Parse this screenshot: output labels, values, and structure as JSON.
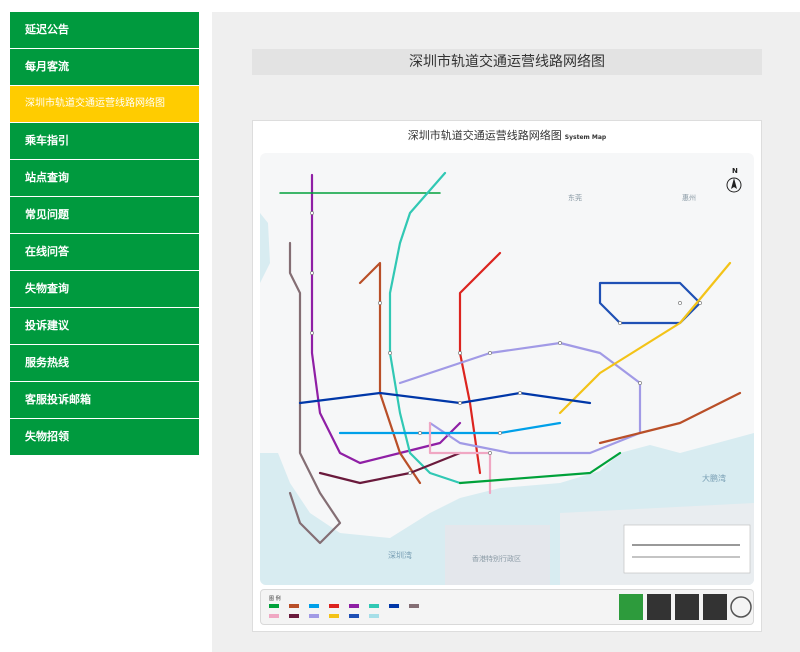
{
  "sidebar": {
    "items": [
      {
        "label": "延迟公告",
        "active": false
      },
      {
        "label": "每月客流",
        "active": false
      },
      {
        "label": "深圳市轨道交通运营线路网络图",
        "active": true
      },
      {
        "label": "乘车指引",
        "active": false
      },
      {
        "label": "站点查询",
        "active": false
      },
      {
        "label": "常见问题",
        "active": false
      },
      {
        "label": "在线问答",
        "active": false
      },
      {
        "label": "失物查询",
        "active": false
      },
      {
        "label": "投诉建议",
        "active": false
      },
      {
        "label": "服务热线",
        "active": false
      },
      {
        "label": "客服投诉邮箱",
        "active": false
      },
      {
        "label": "失物招领",
        "active": false
      }
    ]
  },
  "main": {
    "title": "深圳市轨道交通运营线路网络图",
    "map": {
      "title_cn": "深圳市轨道交通运营线路网络图",
      "title_en": "System Map",
      "north": "N",
      "regions": {
        "dongguan": "东莞",
        "huizhou": "惠州",
        "dapeng_bay": "大鹏湾",
        "shenzhen_bay": "深圳湾",
        "hongkong": "香港特别行政区"
      },
      "legend_title": "图 例"
    }
  },
  "colors": {
    "nav_green": "#009a3e",
    "nav_active": "#ffcc00",
    "line1": "#00a13a",
    "line2": "#b94f28",
    "line3": "#00a0e9",
    "line4": "#dc241f",
    "line5": "#8f1fa5",
    "line6": "#31c8b4",
    "line7": "#0037a8",
    "line9": "#846e74",
    "line10": "#f0a7c3",
    "line11": "#6a1a3c",
    "line12": "#a19ae6",
    "line14": "#f3c318",
    "line16": "#1f50b5",
    "line20": "#a6dfe8",
    "sea": "#d8ecf1"
  }
}
